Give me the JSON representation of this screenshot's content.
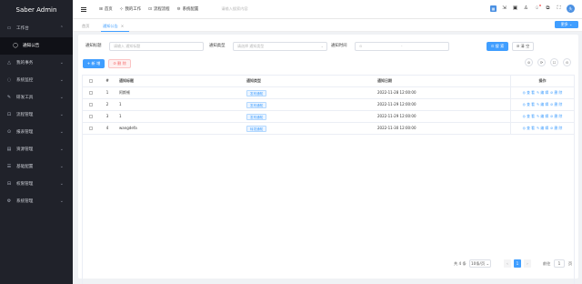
{
  "app": {
    "title": "Saber Admin"
  },
  "sidebar": {
    "items": [
      {
        "label": "工作台",
        "icon": "desktop-icon",
        "chevron": "⌃"
      },
      {
        "label": "通知公告",
        "icon": "notice-icon",
        "sub": true
      },
      {
        "label": "我的事务",
        "icon": "bell-icon",
        "chevron": "⌄"
      },
      {
        "label": "系统监控",
        "icon": "monitor-icon",
        "chevron": "⌄"
      },
      {
        "label": "研发工具",
        "icon": "wrench-icon",
        "chevron": "⌄"
      },
      {
        "label": "流程管理",
        "icon": "flow-icon",
        "chevron": "⌄"
      },
      {
        "label": "报表管理",
        "icon": "report-icon",
        "chevron": "⌄"
      },
      {
        "label": "资源管理",
        "icon": "resource-icon",
        "chevron": "⌄"
      },
      {
        "label": "基础配置",
        "icon": "config-icon",
        "chevron": "⌄"
      },
      {
        "label": "权限管理",
        "icon": "lock-icon",
        "chevron": "⌄"
      },
      {
        "label": "系统管理",
        "icon": "gear-icon",
        "chevron": "⌄"
      }
    ]
  },
  "header": {
    "nav": [
      {
        "label": "首页",
        "icon": "grid-icon"
      },
      {
        "label": "我的工作",
        "icon": "task-icon"
      },
      {
        "label": "流程流程",
        "icon": "flow-icon"
      },
      {
        "label": "系统配置",
        "icon": "gear-icon"
      }
    ],
    "search_placeholder": "请输入搜索内容",
    "tools": [
      "blue-icon",
      "expand-icon",
      "lock-icon",
      "shirt-icon",
      "bell-icon",
      "notification-icon",
      "fullscreen-icon"
    ],
    "avatar_text": "头"
  },
  "tabs": {
    "home": "首页",
    "active": "通知公告",
    "close": "×",
    "more": "更多 ⌄"
  },
  "filter": {
    "title_label": "通知标题",
    "title_placeholder": "请输入 通知标题",
    "type_label": "通知类型",
    "type_placeholder": "请选择 通知类型",
    "time_label": "通知时间",
    "time_icon": "⊙",
    "time_sep": "-",
    "search_btn": "⊙ 搜 索",
    "clear_btn": "⊘ 清 空"
  },
  "actions": {
    "add": "+ 新 增",
    "delete": "⊘ 删 除"
  },
  "circle_tools": [
    "⊘",
    "⟳",
    "☐",
    "⊙"
  ],
  "table": {
    "headers": {
      "idx": "#",
      "title": "通知标题",
      "type": "通知类型",
      "date": "通知日期",
      "ops": "操作"
    },
    "rows": [
      {
        "idx": "1",
        "title": "阿斯顿",
        "type": "发布通知",
        "date": "2022-11-28 12:00:00"
      },
      {
        "idx": "2",
        "title": "1",
        "type": "发布通知",
        "date": "2022-11-29 12:00:00"
      },
      {
        "idx": "3",
        "title": "1",
        "type": "发布通知",
        "date": "2022-11-29 12:00:00"
      },
      {
        "idx": "4",
        "title": "wangdefa",
        "type": "转发通知",
        "date": "2022-11-30 12:00:00"
      }
    ],
    "ops": {
      "view": "◎ 查 看",
      "edit": "✎ 编 辑",
      "del": "⊘ 删 除"
    }
  },
  "pager": {
    "total": "共 4 条",
    "size": "10条/页 ⌄",
    "prev": "‹",
    "current": "1",
    "next": "›",
    "goto": "前往",
    "goto_value": "1",
    "page_unit": "页"
  }
}
